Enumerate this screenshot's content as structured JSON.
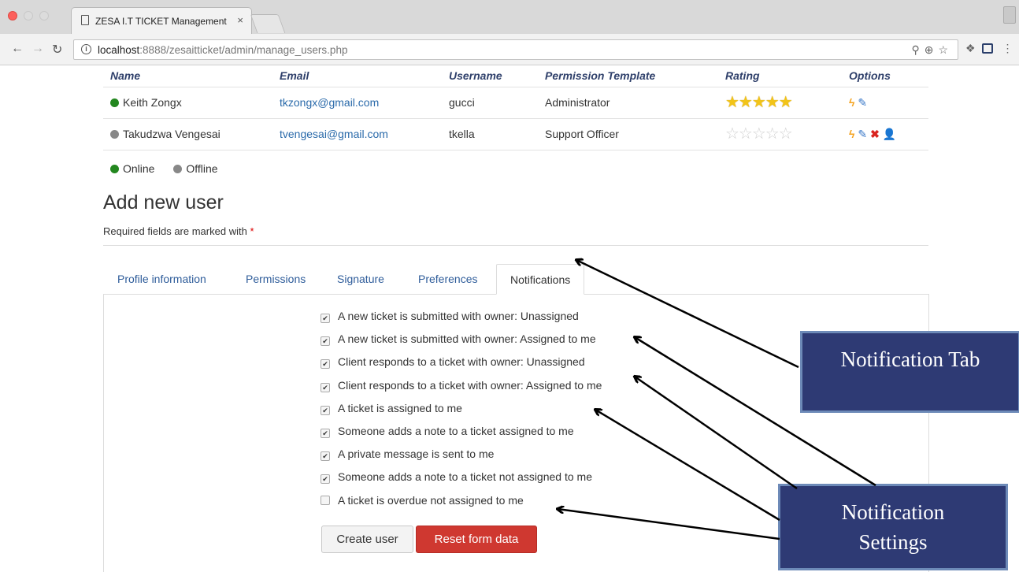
{
  "browser": {
    "tab_title": "ZESA I.T TICKET Management",
    "tab_close": "×",
    "url_host": "localhost",
    "url_rest": ":8888/zesaitticket/admin/manage_users.php"
  },
  "users_table": {
    "headers": [
      "Name",
      "Email",
      "Username",
      "Permission Template",
      "Rating",
      "Options"
    ],
    "rows": [
      {
        "status": "online",
        "name": "Keith Zongx",
        "email": "tkzongx@gmail.com",
        "username": "gucci",
        "template": "Administrator",
        "rating": 5
      },
      {
        "status": "offline",
        "name": "Takudzwa Vengesai",
        "email": "tvengesai@gmail.com",
        "username": "tkella",
        "template": "Support Officer",
        "rating": 0
      }
    ]
  },
  "legend": {
    "online": "Online",
    "offline": "Offline"
  },
  "form": {
    "title": "Add new user",
    "required_note": "Required fields are marked with",
    "required_mark": "*",
    "tabs": [
      "Profile information",
      "Permissions",
      "Signature",
      "Preferences",
      "Notifications"
    ],
    "active_tab": "Notifications",
    "notifications": [
      {
        "label": "A new ticket is submitted with owner: Unassigned",
        "checked": true
      },
      {
        "label": "A new ticket is submitted with owner: Assigned to me",
        "checked": true
      },
      {
        "label": "Client responds to a ticket with owner: Unassigned",
        "checked": true
      },
      {
        "label": "Client responds to a ticket with owner: Assigned to me",
        "checked": true
      },
      {
        "label": "A ticket is assigned to me",
        "checked": true
      },
      {
        "label": "Someone adds a note to a ticket assigned to me",
        "checked": true
      },
      {
        "label": "A private message is sent to me",
        "checked": true
      },
      {
        "label": "Someone adds a note to a ticket not assigned to me",
        "checked": true
      },
      {
        "label": "A ticket is overdue not assigned to me",
        "checked": false
      }
    ],
    "create_button": "Create user",
    "reset_button": "Reset form data"
  },
  "annotations": {
    "notification_tab": "Notification Tab",
    "notification_settings_line1": "Notification",
    "notification_settings_line2": "Settings"
  },
  "colors": {
    "accent": "#2e3f6a",
    "link": "#2a6aaa",
    "online": "#23871f",
    "offline": "#888888",
    "danger": "#cf3830",
    "callout_fill": "#2e3a74",
    "callout_border": "#6d8ab8"
  }
}
